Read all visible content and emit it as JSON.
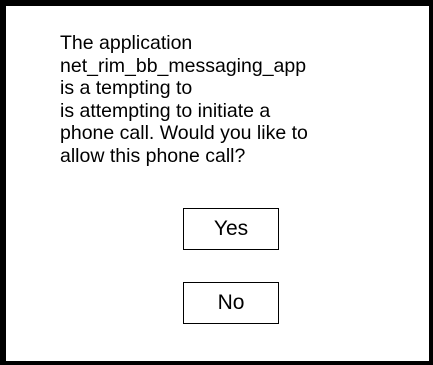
{
  "dialog": {
    "message_lines": [
      "The application",
      "net_rim_bb_messaging_app",
      "is a tempting to",
      "is attempting to initiate a",
      "phone call. Would you like to",
      "allow this phone call?"
    ],
    "yes_label": "Yes",
    "no_label": "No"
  }
}
